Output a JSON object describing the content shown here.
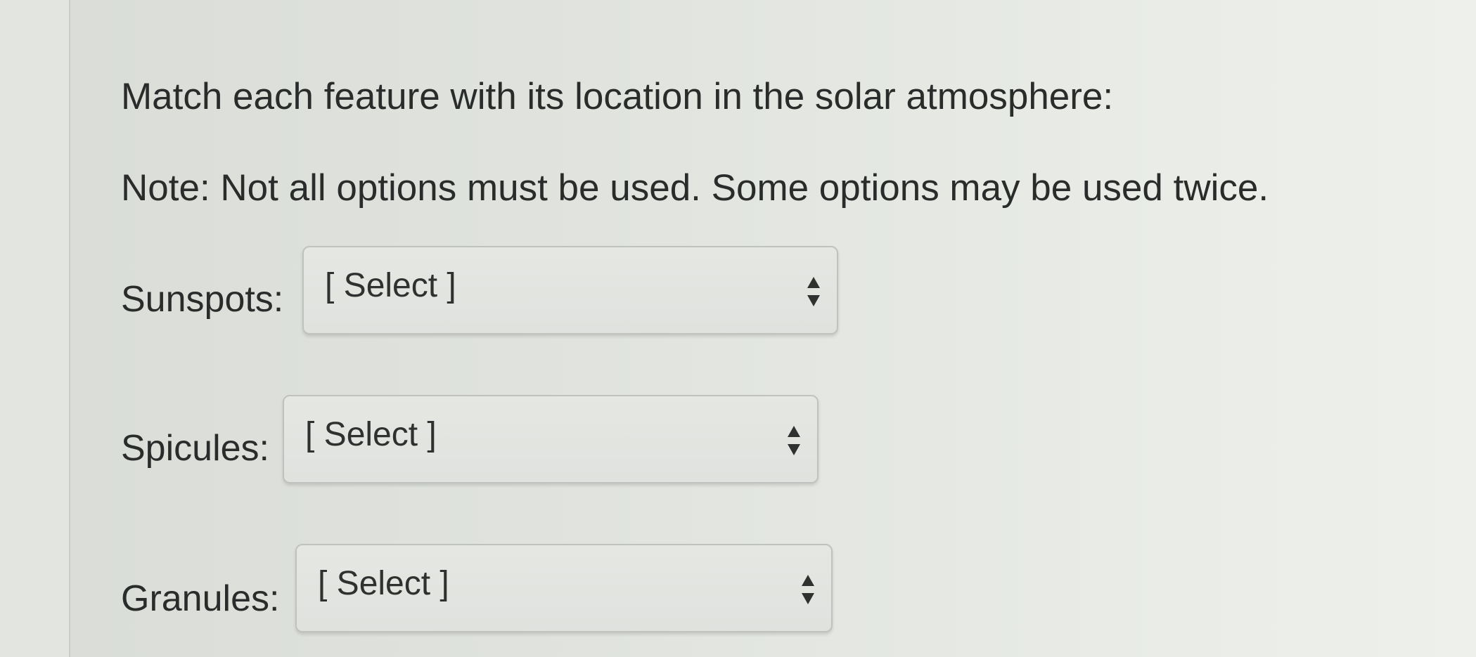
{
  "question": {
    "title": "Match each feature with its location in the solar atmosphere:",
    "note": "Note: Not all options must be used. Some options may be used twice."
  },
  "matches": [
    {
      "label": "Sunspots:",
      "selected": "[ Select ]"
    },
    {
      "label": "Spicules:",
      "selected": "[ Select ]"
    },
    {
      "label": "Granules:",
      "selected": "[ Select ]"
    }
  ],
  "icons": {
    "select_arrows": "up-down-arrows-icon"
  },
  "colors": {
    "background": "#e0e3de",
    "text": "#2a2c2b",
    "select_border": "#bfc2bd"
  }
}
